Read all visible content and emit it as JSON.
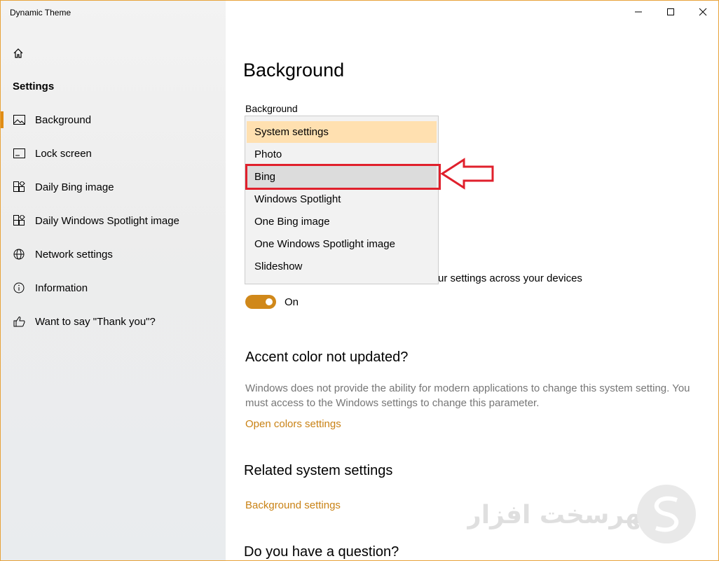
{
  "window": {
    "title": "Dynamic Theme"
  },
  "sidebar": {
    "heading": "Settings",
    "items": [
      {
        "label": "Background",
        "icon": "image-icon",
        "active": true
      },
      {
        "label": "Lock screen",
        "icon": "lock-screen-icon"
      },
      {
        "label": "Daily Bing image",
        "icon": "tiles-icon"
      },
      {
        "label": "Daily Windows Spotlight image",
        "icon": "tiles-icon"
      },
      {
        "label": "Network settings",
        "icon": "globe-icon"
      },
      {
        "label": "Information",
        "icon": "info-icon"
      },
      {
        "label": "Want to say \"Thank you\"?",
        "icon": "thumbs-up-icon"
      }
    ]
  },
  "main": {
    "title": "Background",
    "background_label": "Background",
    "dropdown": {
      "options": [
        "System settings",
        "Photo",
        "Bing",
        "Windows Spotlight",
        "One Bing image",
        "One Windows Spotlight image",
        "Slideshow"
      ],
      "selected": "System settings",
      "hovered": "Bing"
    },
    "sync_text": "ur settings across your devices",
    "toggle": {
      "state": "On"
    },
    "accent": {
      "title": "Accent color not updated?",
      "description": "Windows does not provide the ability for modern applications to change this system setting. You must access to the Windows settings to change this parameter.",
      "link": "Open colors settings"
    },
    "related": {
      "title": "Related system settings",
      "link": "Background settings"
    },
    "question": {
      "title": "Do you have a question?"
    }
  },
  "annotation": {
    "highlight_color": "#e0202c"
  },
  "colors": {
    "accent": "#d0881a",
    "link": "#c98215",
    "selected_bg": "#ffe0b0"
  },
  "watermark": {
    "text": "سهرسخت افزار"
  }
}
